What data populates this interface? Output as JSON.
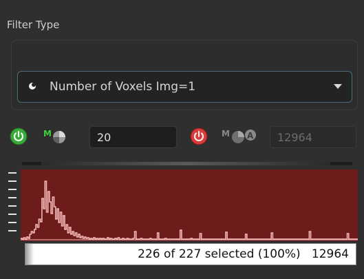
{
  "panel": {
    "title": "Filter Type"
  },
  "filter": {
    "selected": "Number of Voxels Img=1"
  },
  "lower": {
    "value": "20",
    "mode_label": "M"
  },
  "upper": {
    "value": "12964",
    "mode_label": "M"
  },
  "histogram": {
    "bins": [
      2,
      1,
      3,
      1,
      4,
      2,
      8,
      12,
      10,
      15,
      22,
      18,
      30,
      26,
      60,
      45,
      85,
      40,
      70,
      55,
      38,
      62,
      48,
      30,
      45,
      25,
      40,
      20,
      35,
      15,
      22,
      10,
      18,
      8,
      12,
      6,
      10,
      4,
      8,
      3,
      5,
      2,
      4,
      2,
      3,
      1,
      2,
      1,
      3,
      1,
      2,
      1,
      2,
      1,
      2,
      1,
      1,
      3,
      1,
      2,
      1,
      1,
      2,
      1,
      3,
      1,
      1,
      2,
      1,
      1,
      2,
      1,
      1,
      1,
      2,
      1,
      1,
      1,
      1,
      2,
      1,
      1,
      1,
      1,
      1,
      2,
      1,
      1,
      1,
      1,
      1,
      1,
      1,
      1,
      1,
      2,
      1,
      1,
      1,
      1,
      1,
      1,
      1,
      1,
      1,
      1,
      1,
      1,
      1,
      1,
      1,
      1,
      2,
      1,
      1,
      1,
      1,
      1,
      1,
      1,
      1,
      1,
      1,
      1,
      1,
      1,
      1,
      1,
      1,
      1,
      1,
      1,
      1,
      1,
      1,
      1,
      1,
      1,
      1,
      1,
      1,
      1,
      1,
      1,
      1,
      1,
      1,
      1,
      1,
      1,
      1,
      1,
      1,
      1,
      1,
      1,
      1,
      1,
      1,
      1,
      1,
      1,
      1,
      1,
      1,
      1,
      1,
      1,
      1,
      1,
      1,
      1,
      1,
      1,
      1,
      1,
      1,
      1,
      1,
      1,
      1,
      1,
      1,
      1,
      1,
      1,
      1,
      1,
      1,
      1,
      1,
      1,
      1,
      1,
      1,
      1,
      1,
      1,
      1,
      1,
      1,
      1,
      1,
      1,
      1,
      1,
      1,
      1,
      1,
      1,
      1,
      1,
      1,
      1,
      1,
      1,
      1,
      1,
      1,
      1,
      1,
      1
    ],
    "spikes": [
      {
        "bin": 75,
        "value": 12
      },
      {
        "bin": 90,
        "value": 10
      },
      {
        "bin": 105,
        "value": 14
      },
      {
        "bin": 118,
        "value": 9
      },
      {
        "bin": 135,
        "value": 11
      },
      {
        "bin": 148,
        "value": 8
      },
      {
        "bin": 165,
        "value": 10
      },
      {
        "bin": 190,
        "value": 12
      },
      {
        "bin": 215,
        "value": 9
      }
    ],
    "max": 90,
    "colors": {
      "background": "#6e1b1b",
      "bars": "#f4b8b8"
    }
  },
  "status": {
    "text": "226 of 227 selected (100%)   12964"
  }
}
